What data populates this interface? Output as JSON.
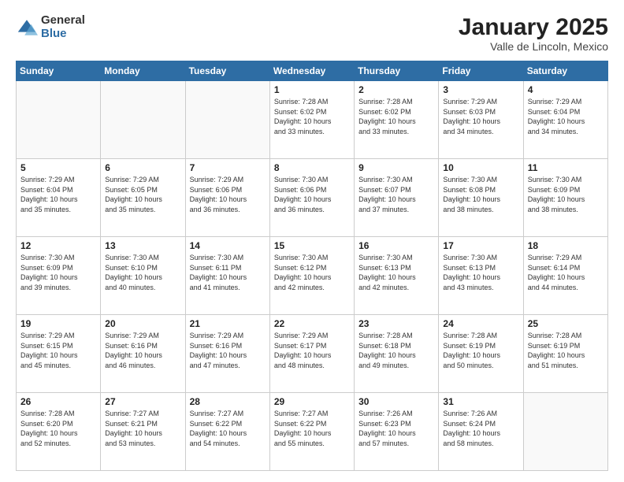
{
  "logo": {
    "general": "General",
    "blue": "Blue"
  },
  "header": {
    "month": "January 2025",
    "location": "Valle de Lincoln, Mexico"
  },
  "weekdays": [
    "Sunday",
    "Monday",
    "Tuesday",
    "Wednesday",
    "Thursday",
    "Friday",
    "Saturday"
  ],
  "weeks": [
    [
      {
        "day": "",
        "info": ""
      },
      {
        "day": "",
        "info": ""
      },
      {
        "day": "",
        "info": ""
      },
      {
        "day": "1",
        "info": "Sunrise: 7:28 AM\nSunset: 6:02 PM\nDaylight: 10 hours\nand 33 minutes."
      },
      {
        "day": "2",
        "info": "Sunrise: 7:28 AM\nSunset: 6:02 PM\nDaylight: 10 hours\nand 33 minutes."
      },
      {
        "day": "3",
        "info": "Sunrise: 7:29 AM\nSunset: 6:03 PM\nDaylight: 10 hours\nand 34 minutes."
      },
      {
        "day": "4",
        "info": "Sunrise: 7:29 AM\nSunset: 6:04 PM\nDaylight: 10 hours\nand 34 minutes."
      }
    ],
    [
      {
        "day": "5",
        "info": "Sunrise: 7:29 AM\nSunset: 6:04 PM\nDaylight: 10 hours\nand 35 minutes."
      },
      {
        "day": "6",
        "info": "Sunrise: 7:29 AM\nSunset: 6:05 PM\nDaylight: 10 hours\nand 35 minutes."
      },
      {
        "day": "7",
        "info": "Sunrise: 7:29 AM\nSunset: 6:06 PM\nDaylight: 10 hours\nand 36 minutes."
      },
      {
        "day": "8",
        "info": "Sunrise: 7:30 AM\nSunset: 6:06 PM\nDaylight: 10 hours\nand 36 minutes."
      },
      {
        "day": "9",
        "info": "Sunrise: 7:30 AM\nSunset: 6:07 PM\nDaylight: 10 hours\nand 37 minutes."
      },
      {
        "day": "10",
        "info": "Sunrise: 7:30 AM\nSunset: 6:08 PM\nDaylight: 10 hours\nand 38 minutes."
      },
      {
        "day": "11",
        "info": "Sunrise: 7:30 AM\nSunset: 6:09 PM\nDaylight: 10 hours\nand 38 minutes."
      }
    ],
    [
      {
        "day": "12",
        "info": "Sunrise: 7:30 AM\nSunset: 6:09 PM\nDaylight: 10 hours\nand 39 minutes."
      },
      {
        "day": "13",
        "info": "Sunrise: 7:30 AM\nSunset: 6:10 PM\nDaylight: 10 hours\nand 40 minutes."
      },
      {
        "day": "14",
        "info": "Sunrise: 7:30 AM\nSunset: 6:11 PM\nDaylight: 10 hours\nand 41 minutes."
      },
      {
        "day": "15",
        "info": "Sunrise: 7:30 AM\nSunset: 6:12 PM\nDaylight: 10 hours\nand 42 minutes."
      },
      {
        "day": "16",
        "info": "Sunrise: 7:30 AM\nSunset: 6:13 PM\nDaylight: 10 hours\nand 42 minutes."
      },
      {
        "day": "17",
        "info": "Sunrise: 7:30 AM\nSunset: 6:13 PM\nDaylight: 10 hours\nand 43 minutes."
      },
      {
        "day": "18",
        "info": "Sunrise: 7:29 AM\nSunset: 6:14 PM\nDaylight: 10 hours\nand 44 minutes."
      }
    ],
    [
      {
        "day": "19",
        "info": "Sunrise: 7:29 AM\nSunset: 6:15 PM\nDaylight: 10 hours\nand 45 minutes."
      },
      {
        "day": "20",
        "info": "Sunrise: 7:29 AM\nSunset: 6:16 PM\nDaylight: 10 hours\nand 46 minutes."
      },
      {
        "day": "21",
        "info": "Sunrise: 7:29 AM\nSunset: 6:16 PM\nDaylight: 10 hours\nand 47 minutes."
      },
      {
        "day": "22",
        "info": "Sunrise: 7:29 AM\nSunset: 6:17 PM\nDaylight: 10 hours\nand 48 minutes."
      },
      {
        "day": "23",
        "info": "Sunrise: 7:28 AM\nSunset: 6:18 PM\nDaylight: 10 hours\nand 49 minutes."
      },
      {
        "day": "24",
        "info": "Sunrise: 7:28 AM\nSunset: 6:19 PM\nDaylight: 10 hours\nand 50 minutes."
      },
      {
        "day": "25",
        "info": "Sunrise: 7:28 AM\nSunset: 6:19 PM\nDaylight: 10 hours\nand 51 minutes."
      }
    ],
    [
      {
        "day": "26",
        "info": "Sunrise: 7:28 AM\nSunset: 6:20 PM\nDaylight: 10 hours\nand 52 minutes."
      },
      {
        "day": "27",
        "info": "Sunrise: 7:27 AM\nSunset: 6:21 PM\nDaylight: 10 hours\nand 53 minutes."
      },
      {
        "day": "28",
        "info": "Sunrise: 7:27 AM\nSunset: 6:22 PM\nDaylight: 10 hours\nand 54 minutes."
      },
      {
        "day": "29",
        "info": "Sunrise: 7:27 AM\nSunset: 6:22 PM\nDaylight: 10 hours\nand 55 minutes."
      },
      {
        "day": "30",
        "info": "Sunrise: 7:26 AM\nSunset: 6:23 PM\nDaylight: 10 hours\nand 57 minutes."
      },
      {
        "day": "31",
        "info": "Sunrise: 7:26 AM\nSunset: 6:24 PM\nDaylight: 10 hours\nand 58 minutes."
      },
      {
        "day": "",
        "info": ""
      }
    ]
  ]
}
